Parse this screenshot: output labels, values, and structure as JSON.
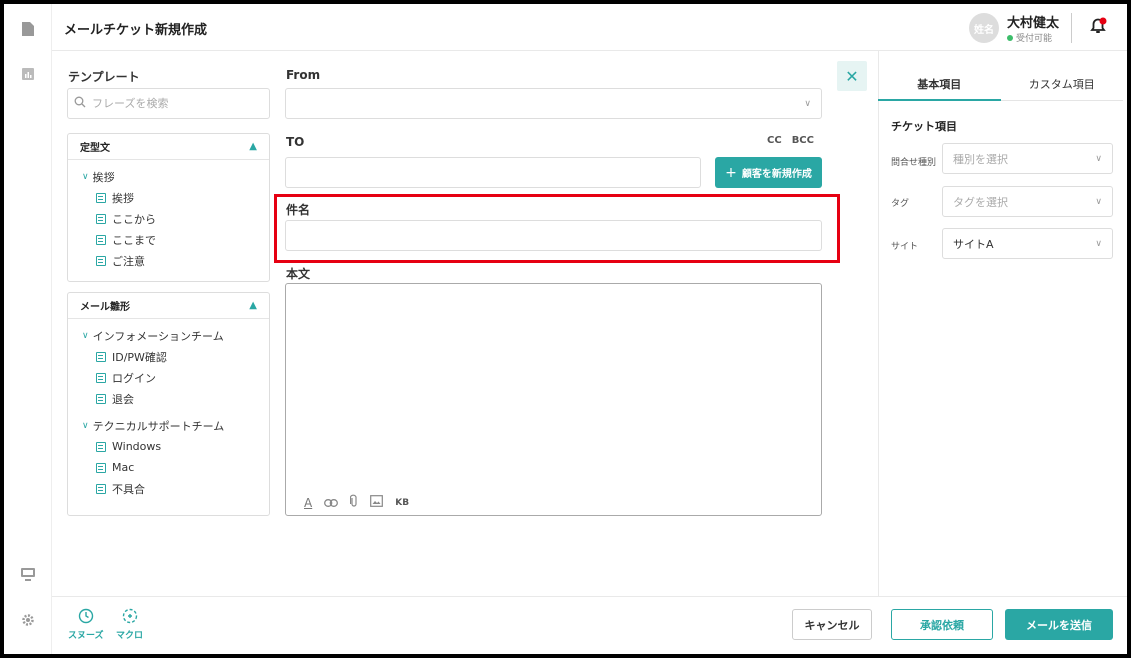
{
  "header": {
    "title": "メールチケット新規作成",
    "avatar_text": "姓名",
    "user_name": "大村健太",
    "user_status": "受付可能"
  },
  "sidebar_rail": {
    "icons": [
      "document-icon",
      "chart-icon",
      "monitor-icon",
      "gear-icon"
    ]
  },
  "templates": {
    "label": "テンプレート",
    "search_placeholder": "フレーズを検索",
    "panels": [
      {
        "title": "定型文",
        "groups": [
          {
            "name": "挨拶",
            "items": [
              "挨拶",
              "ここから",
              "ここまで",
              "ご注意"
            ]
          }
        ]
      },
      {
        "title": "メール雛形",
        "groups": [
          {
            "name": "インフォメーションチーム",
            "items": [
              "ID/PW確認",
              "ログイン",
              "退会"
            ]
          },
          {
            "name": "テクニカルサポートチーム",
            "items": [
              "Windows",
              "Mac",
              "不具合"
            ]
          }
        ]
      }
    ]
  },
  "form": {
    "from_label": "From",
    "from_value": "",
    "to_label": "TO",
    "to_value": "",
    "cc_label": "CC",
    "bcc_label": "BCC",
    "new_customer_label": "顧客を新規作成",
    "subject_label": "件名",
    "subject_value": "",
    "body_label": "本文",
    "body_value": "",
    "kb_label": "KB"
  },
  "right_panel": {
    "tabs": [
      "基本項目",
      "カスタム項目"
    ],
    "active_tab": "基本項目",
    "section_title": "チケット項目",
    "fields": [
      {
        "label": "問合せ種別",
        "placeholder": "種別を選択",
        "value": ""
      },
      {
        "label": "タグ",
        "placeholder": "タグを選択",
        "value": ""
      },
      {
        "label": "サイト",
        "placeholder": "",
        "value": "サイトA"
      }
    ]
  },
  "footer": {
    "snooze_label": "スヌーズ",
    "macro_label": "マクロ",
    "cancel_label": "キャンセル",
    "approve_label": "承認依頼",
    "send_label": "メールを送信"
  },
  "colors": {
    "accent": "#2aa7a4",
    "highlight": "#e60012",
    "status_online": "#3cbd6a"
  }
}
